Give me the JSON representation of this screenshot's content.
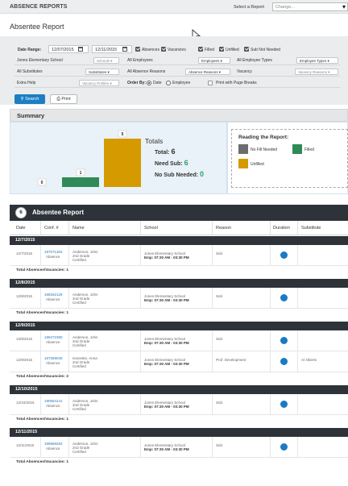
{
  "header": {
    "app_title": "ABSENCE REPORTS",
    "select_report_label": "Select a Report",
    "select_report_placeholder": "Change...",
    "page_title": "Absentee Report"
  },
  "filters": {
    "date_range_label": "Date Range:",
    "date_from": "12/07/2015",
    "date_to": "12/11/2015",
    "checkboxes": [
      {
        "label": "Absences",
        "checked": true
      },
      {
        "label": "Vacancies",
        "checked": true
      },
      {
        "label": "Filled",
        "checked": true
      },
      {
        "label": "Unfilled",
        "checked": true
      },
      {
        "label": "Sub Not Needed",
        "checked": true
      }
    ],
    "rows": [
      {
        "left_text": "Jones Elementary School",
        "left_dd": "Schools",
        "mid_text": "All Employees",
        "mid_dd": "Employees",
        "right_text": "All Employee Types",
        "right_dd": "Employee Types"
      },
      {
        "left_text": "All Substitutes",
        "left_dd": "Substitutes",
        "mid_text": "All Absence Reasons",
        "mid_dd": "Absence Reasons",
        "right_text": "Vacancy",
        "right_dd": "Vacancy Reasons"
      },
      {
        "left_text": "Extra Help",
        "left_dd": "Vacancy Profiles"
      }
    ],
    "order_by_label": "Order By:",
    "order_options": [
      {
        "label": "Date",
        "selected": true
      },
      {
        "label": "Employee",
        "selected": false
      }
    ],
    "print_breaks_label": "Print with Page Breaks",
    "search_label": "Search",
    "print_label": "Print"
  },
  "summary": {
    "title": "Summary",
    "totals_title": "Totals",
    "total_label": "Total:",
    "total_value": "6",
    "need_sub_label": "Need Sub:",
    "need_sub_value": "6",
    "no_sub_label": "No Sub Needed:",
    "no_sub_value": "0",
    "chart_data": {
      "type": "bar",
      "categories": [
        "No Fill Needed",
        "Filled",
        "Unfilled"
      ],
      "values": [
        0,
        1,
        5
      ],
      "colors": [
        "#6d6d6d",
        "#2e8b57",
        "#d49a00"
      ]
    },
    "legend": {
      "title": "Reading the Report:",
      "items": [
        {
          "label": "No Fill Needed",
          "color": "#6d6d6d"
        },
        {
          "label": "Filled",
          "color": "#2e8b57"
        },
        {
          "label": "Unfilled",
          "color": "#d49a00"
        }
      ]
    }
  },
  "report": {
    "count": "6",
    "title": "Absentee Report",
    "columns": [
      "Date",
      "Conf. #",
      "Name",
      "School",
      "Reason",
      "Duration",
      "Substitute"
    ],
    "groups": [
      {
        "date": "12/7/2015",
        "total": "Total Absences/Vacancies: 1",
        "rows": [
          {
            "date": "12/7/2015",
            "conf": "187071304",
            "type": "Absence",
            "name": "Anderson, John",
            "grade": "2nd Grade",
            "cert": "Certified",
            "school": "Jones Elementary School",
            "emp": "Emp: 07:30 AM - 03:30 PM",
            "reason": "Sick",
            "substitute": ""
          }
        ]
      },
      {
        "date": "12/8/2015",
        "total": "Total Absences/Vacancies: 1",
        "rows": [
          {
            "date": "12/8/2015",
            "conf": "188262129",
            "type": "Absence",
            "name": "Anderson, John",
            "grade": "2nd Grade",
            "cert": "Certified",
            "school": "Jones Elementary School",
            "emp": "Emp: 07:30 AM - 03:30 PM",
            "reason": "Sick",
            "substitute": ""
          }
        ]
      },
      {
        "date": "12/9/2015",
        "total": "Total Absences/Vacancies: 2",
        "rows": [
          {
            "date": "12/9/2015",
            "conf": "189472380",
            "type": "Absence",
            "name": "Anderson, John",
            "grade": "2nd Grade",
            "cert": "Certified",
            "school": "Jones Elementary School",
            "emp": "Emp: 07:30 AM - 03:30 PM",
            "reason": "Sick",
            "substitute": ""
          },
          {
            "date": "12/9/2015",
            "conf": "187369049",
            "type": "Absence",
            "name": "Isoneske, Anna",
            "grade": "2nd Grade",
            "cert": "Certified",
            "school": "Jones Elementary School",
            "emp": "Emp: 07:30 AM - 03:30 PM",
            "reason": "Prof. Development",
            "substitute": "Al Alberts"
          }
        ]
      },
      {
        "date": "12/10/2015",
        "total": "Total Absences/Vacancies: 1",
        "rows": [
          {
            "date": "12/10/2015",
            "conf": "190664141",
            "type": "Absence",
            "name": "Anderson, John",
            "grade": "2nd Grade",
            "cert": "Certified",
            "school": "Jones Elementary School",
            "emp": "Emp: 07:30 AM - 03:30 PM",
            "reason": "Sick",
            "substitute": ""
          }
        ]
      },
      {
        "date": "12/11/2015",
        "total": "Total Absences/Vacancies: 1",
        "rows": [
          {
            "date": "12/11/2015",
            "conf": "189868284",
            "type": "Absence",
            "name": "Anderson, John",
            "grade": "2nd Grade",
            "cert": "Certified",
            "school": "Jones Elementary School",
            "emp": "Emp: 07:30 AM - 03:30 PM",
            "reason": "Sick",
            "substitute": ""
          }
        ]
      }
    ]
  }
}
